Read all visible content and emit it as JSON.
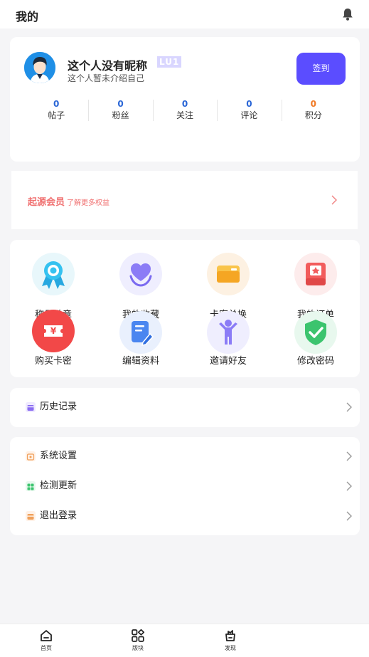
{
  "header": {
    "title": "我的"
  },
  "profile": {
    "nickname": "这个人没有昵称",
    "level": "LU1",
    "bio": "这个人暂未介绍自己",
    "signin_label": "签到",
    "stats": [
      {
        "value": "0",
        "label": "帖子"
      },
      {
        "value": "0",
        "label": "粉丝"
      },
      {
        "value": "0",
        "label": "关注"
      },
      {
        "value": "0",
        "label": "评论"
      },
      {
        "value": "0",
        "label": "积分"
      }
    ]
  },
  "member": {
    "title": "起源会员",
    "subtitle": "了解更多权益"
  },
  "grid": [
    {
      "label": "称号勋章",
      "icon": "medal-icon"
    },
    {
      "label": "我的收藏",
      "icon": "heart-icon"
    },
    {
      "label": "卡密兑换",
      "icon": "card-wallet-icon"
    },
    {
      "label": "我的订单",
      "icon": "order-icon"
    },
    {
      "label": "购买卡密",
      "icon": "ticket-icon"
    },
    {
      "label": "编辑资料",
      "icon": "edit-icon"
    },
    {
      "label": "邀请好友",
      "icon": "person-icon"
    },
    {
      "label": "修改密码",
      "icon": "shield-check-icon"
    }
  ],
  "history": {
    "label": "历史记录"
  },
  "settings": [
    {
      "label": "系统设置"
    },
    {
      "label": "检测更新"
    },
    {
      "label": "退出登录"
    }
  ],
  "nav": [
    {
      "label": "首页"
    },
    {
      "label": "版块"
    },
    {
      "label": "发现"
    }
  ],
  "colors": {
    "accent": "#5b4dff",
    "member": "#f07070",
    "stat": "#2a66d6",
    "points": "#f07a25"
  }
}
